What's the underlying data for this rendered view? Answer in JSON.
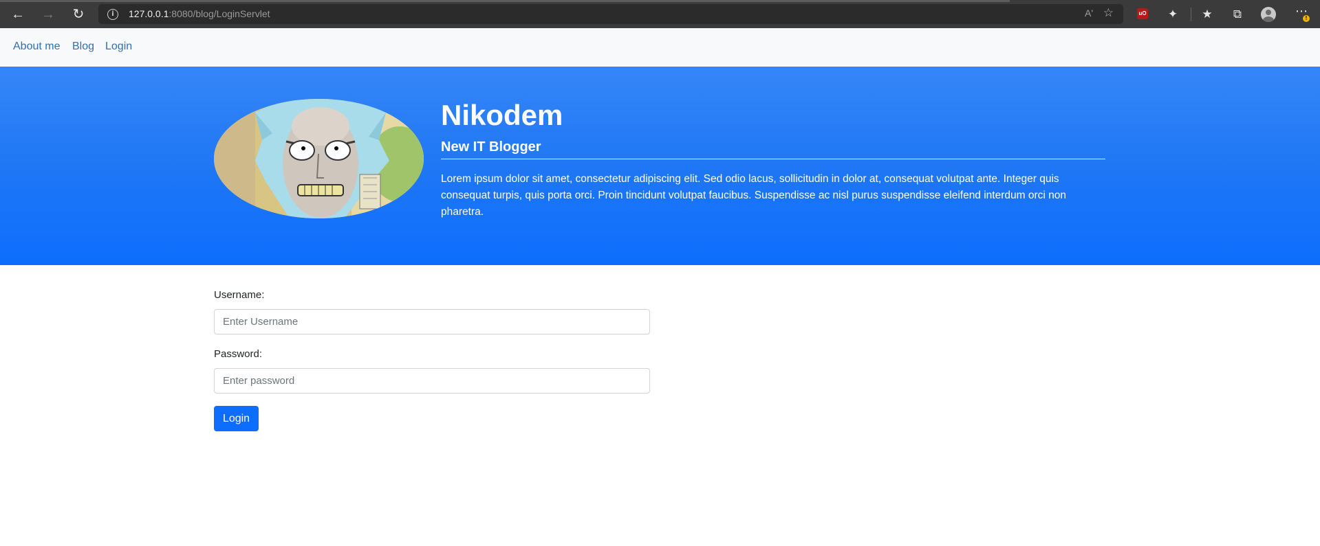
{
  "browser": {
    "url_host": "127.0.0.1",
    "url_rest": ":8080/blog/LoginServlet",
    "read_aloud": "Aʹ",
    "ublock_badge": "uO"
  },
  "nav": {
    "items": [
      {
        "label": "About me"
      },
      {
        "label": "Blog"
      },
      {
        "label": "Login"
      }
    ]
  },
  "hero": {
    "title": "Nikodem",
    "subtitle": "New IT Blogger",
    "description": "Lorem ipsum dolor sit amet, consectetur adipiscing elit. Sed odio lacus, sollicitudin in dolor at, consequat volutpat ante. Integer quis consequat turpis, quis porta orci. Proin tincidunt volutpat faucibus. Suspendisse ac nisl purus suspendisse eleifend interdum orci non pharetra.",
    "image_icon": "rick-avatar-illustration"
  },
  "form": {
    "username_label": "Username:",
    "username_placeholder": "Enter Username",
    "username_value": "",
    "password_label": "Password:",
    "password_placeholder": "Enter password",
    "password_value": "",
    "submit_label": "Login"
  },
  "colors": {
    "hero_top": "#3686f7",
    "hero_bottom": "#0d6efd",
    "link": "#2f6fb6",
    "button": "#0d6efd"
  }
}
